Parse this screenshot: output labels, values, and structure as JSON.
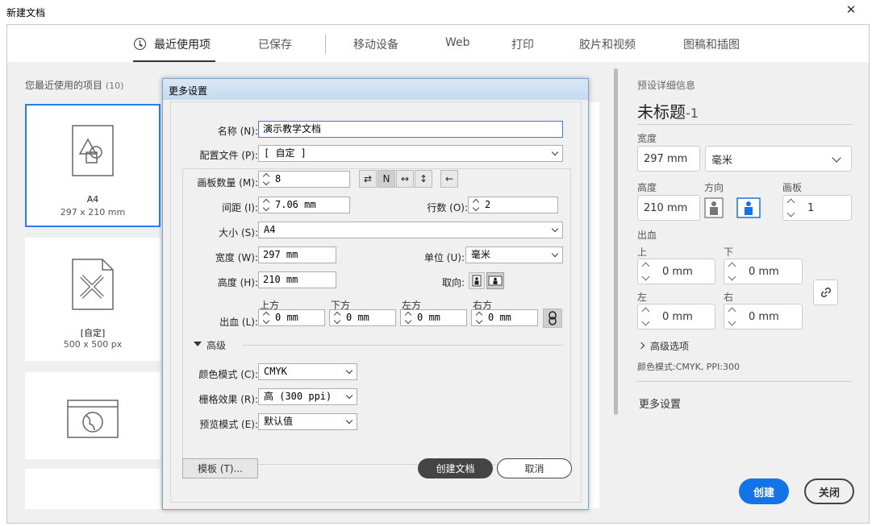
{
  "window": {
    "title": "新建文档",
    "close_glyph": "✕"
  },
  "nav": {
    "tabs": [
      {
        "label": "最近使用项",
        "active": true
      },
      {
        "label": "已保存"
      },
      {
        "label": "移动设备"
      },
      {
        "label": "Web"
      },
      {
        "label": "打印"
      },
      {
        "label": "胶片和视频"
      },
      {
        "label": "图稿和插图"
      }
    ]
  },
  "recent": {
    "label": "您最近使用的项目",
    "count": "(10)",
    "items": [
      {
        "name": "A4",
        "size": "297 x 210 mm",
        "icon": "shapes-document-icon"
      },
      {
        "name": "[自定]",
        "size": "500 x 500 px",
        "icon": "pencil-ruler-document-icon"
      },
      {
        "name": "",
        "size": "",
        "icon": "web-globe-icon"
      }
    ]
  },
  "details": {
    "section_title": "预设详细信息",
    "doc_name": "未标题",
    "doc_suffix": "-1",
    "width_label": "宽度",
    "width_value": "297 mm",
    "unit_value": "毫米",
    "height_label": "高度",
    "height_value": "210 mm",
    "orientation_label": "方向",
    "artboards_label": "画板",
    "artboards_value": "1",
    "bleed_label": "出血",
    "bleed_top_label": "上",
    "bleed_bottom_label": "下",
    "bleed_left_label": "左",
    "bleed_right_label": "右",
    "bleed_top": "0 mm",
    "bleed_bottom": "0 mm",
    "bleed_left": "0 mm",
    "bleed_right": "0 mm",
    "advanced_label": "高级选项",
    "color_info": "颜色模式:CMYK, PPI:300",
    "more_settings": "更多设置",
    "create_label": "创建",
    "close_label": "关闭",
    "accent": "#1473e6"
  },
  "dialog": {
    "title": "更多设置",
    "name_label": "名称 (N):",
    "name_value": "演示教学文档",
    "profile_label": "配置文件 (P):",
    "profile_value": "[ 自定 ]",
    "artboards_label": "画板数量 (M):",
    "artboards_value": "8",
    "spacing_label": "间距 (I):",
    "spacing_value": "7.06 mm",
    "rows_label": "行数 (O):",
    "rows_value": "2",
    "size_label": "大小 (S):",
    "size_value": "A4",
    "width_label": "宽度 (W):",
    "width_value": "297 mm",
    "unit_label": "单位 (U):",
    "unit_value": "毫米",
    "height_label": "高度 (H):",
    "height_value": "210 mm",
    "orient_label": "取向:",
    "bleed_label": "出血 (L):",
    "bleed_top_label": "上方",
    "bleed_bottom_label": "下方",
    "bleed_left_label": "左方",
    "bleed_right_label": "右方",
    "bleed_top": "0 mm",
    "bleed_bottom": "0 mm",
    "bleed_left": "0 mm",
    "bleed_right": "0 mm",
    "advanced_label": "高级",
    "color_label": "颜色模式 (C):",
    "color_value": "CMYK",
    "raster_label": "栅格效果 (R):",
    "raster_value": "高 (300 ppi)",
    "preview_label": "预览模式 (E):",
    "preview_value": "默认值",
    "template_btn": "模板 (T)...",
    "create_btn": "创建文档",
    "cancel_btn": "取消",
    "arrow_left_glyph": "←"
  }
}
